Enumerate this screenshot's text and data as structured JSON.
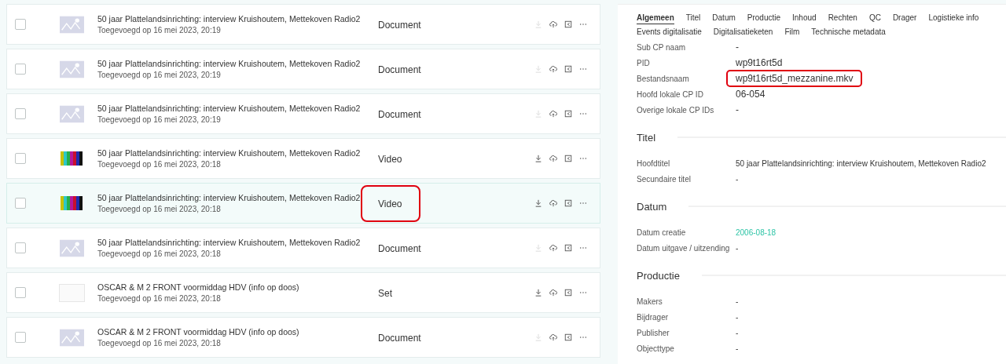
{
  "items": [
    {
      "title": "50 jaar Plattelandsinrichting: interview Kruishoutem, Mettekoven Radio2",
      "added": "Toegevoegd op 16 mei 2023, 20:19",
      "type": "Document",
      "kind": "placeholder",
      "checked": false,
      "download_enabled": false,
      "selected": false,
      "annotated": false
    },
    {
      "title": "50 jaar Plattelandsinrichting: interview Kruishoutem, Mettekoven Radio2",
      "added": "Toegevoegd op 16 mei 2023, 20:19",
      "type": "Document",
      "kind": "placeholder",
      "checked": false,
      "download_enabled": false,
      "selected": false,
      "annotated": false
    },
    {
      "title": "50 jaar Plattelandsinrichting: interview Kruishoutem, Mettekoven Radio2",
      "added": "Toegevoegd op 16 mei 2023, 20:19",
      "type": "Document",
      "kind": "placeholder",
      "checked": false,
      "download_enabled": false,
      "selected": false,
      "annotated": false
    },
    {
      "title": "50 jaar Plattelandsinrichting: interview Kruishoutem, Mettekoven Radio2",
      "added": "Toegevoegd op 16 mei 2023, 20:18",
      "type": "Video",
      "kind": "colorbars",
      "checked": false,
      "download_enabled": true,
      "selected": false,
      "annotated": false
    },
    {
      "title": "50 jaar Plattelandsinrichting: interview Kruishoutem, Mettekoven Radio2",
      "added": "Toegevoegd op 16 mei 2023, 20:18",
      "type": "Video",
      "kind": "colorbars",
      "checked": false,
      "download_enabled": true,
      "selected": true,
      "annotated": true
    },
    {
      "title": "50 jaar Plattelandsinrichting: interview Kruishoutem, Mettekoven Radio2",
      "added": "Toegevoegd op 16 mei 2023, 20:18",
      "type": "Document",
      "kind": "placeholder",
      "checked": false,
      "download_enabled": false,
      "selected": false,
      "annotated": false
    },
    {
      "title": "OSCAR & M 2 FRONT voormiddag HDV (info op doos)",
      "added": "Toegevoegd op 16 mei 2023, 20:18",
      "type": "Set",
      "kind": "unavailable",
      "checked": false,
      "download_enabled": true,
      "selected": false,
      "annotated": false
    },
    {
      "title": "OSCAR & M 2 FRONT voormiddag HDV (info op doos)",
      "added": "Toegevoegd op 16 mei 2023, 20:18",
      "type": "Document",
      "kind": "placeholder",
      "checked": false,
      "download_enabled": false,
      "selected": false,
      "annotated": false
    }
  ],
  "tabs": [
    {
      "label": "Algemeen",
      "selected": true
    },
    {
      "label": "Titel",
      "selected": false
    },
    {
      "label": "Datum",
      "selected": false
    },
    {
      "label": "Productie",
      "selected": false
    },
    {
      "label": "Inhoud",
      "selected": false
    },
    {
      "label": "Rechten",
      "selected": false
    },
    {
      "label": "QC",
      "selected": false
    },
    {
      "label": "Drager",
      "selected": false
    },
    {
      "label": "Logistieke info",
      "selected": false
    },
    {
      "label": "Events digitalisatie",
      "selected": false
    },
    {
      "label": "Digitalisatieketen",
      "selected": false
    },
    {
      "label": "Film",
      "selected": false
    },
    {
      "label": "Technische metadata",
      "selected": false
    }
  ],
  "fields": [
    {
      "label": "Sub CP naam",
      "value": "-",
      "kind": "text",
      "annotated": false
    },
    {
      "label": "PID",
      "value": "wp9t16rt5d",
      "kind": "text",
      "annotated": false
    },
    {
      "label": "Bestandsnaam",
      "value": "wp9t16rt5d_mezzanine.mkv",
      "kind": "text",
      "annotated": true
    },
    {
      "label": "Hoofd lokale CP ID",
      "value": "06-054",
      "kind": "text",
      "annotated": false
    },
    {
      "label": "Overige lokale CP IDs",
      "value": "-",
      "kind": "text",
      "annotated": false
    }
  ],
  "sections": [
    {
      "title": "Titel",
      "fields": [
        {
          "label": "Hoofdtitel",
          "value": "50 jaar Plattelandsinrichting: interview Kruishoutem, Mettekoven Radio2",
          "kind": "text",
          "annotated": false
        },
        {
          "label": "Secundaire titel",
          "value": "-",
          "kind": "text",
          "annotated": false
        }
      ]
    },
    {
      "title": "Datum",
      "fields": [
        {
          "label": "Datum creatie",
          "value": "2006-08-18",
          "kind": "link",
          "annotated": false
        },
        {
          "label": "Datum uitgave / uitzending",
          "value": "-",
          "kind": "text",
          "annotated": false
        }
      ]
    },
    {
      "title": "Productie",
      "fields": [
        {
          "label": "Makers",
          "value": "-",
          "kind": "text",
          "annotated": false
        },
        {
          "label": "Bijdrager",
          "value": "-",
          "kind": "text",
          "annotated": false
        },
        {
          "label": "Publisher",
          "value": "-",
          "kind": "text",
          "annotated": false
        },
        {
          "label": "Objecttype",
          "value": "-",
          "kind": "text",
          "annotated": false
        }
      ]
    }
  ]
}
